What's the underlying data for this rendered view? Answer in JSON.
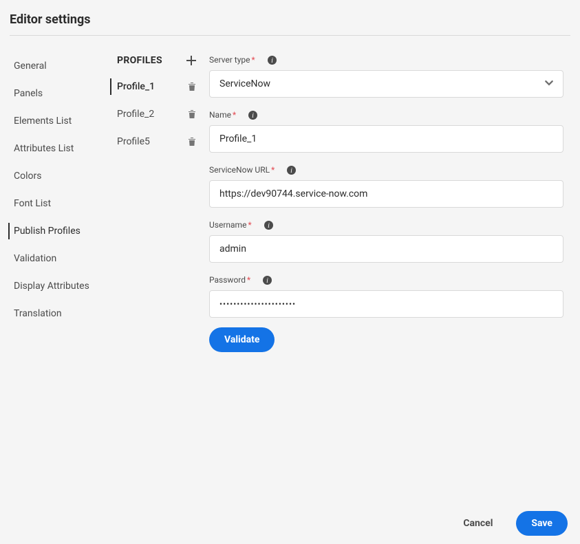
{
  "page_title": "Editor settings",
  "sidebar": {
    "items": [
      {
        "label": "General"
      },
      {
        "label": "Panels"
      },
      {
        "label": "Elements List"
      },
      {
        "label": "Attributes List"
      },
      {
        "label": "Colors"
      },
      {
        "label": "Font List"
      },
      {
        "label": "Publish Profiles"
      },
      {
        "label": "Validation"
      },
      {
        "label": "Display Attributes"
      },
      {
        "label": "Translation"
      }
    ],
    "active_index": 6
  },
  "profiles": {
    "header": "PROFILES",
    "items": [
      {
        "label": "Profile_1"
      },
      {
        "label": "Profile_2"
      },
      {
        "label": "Profile5"
      }
    ],
    "active_index": 0
  },
  "form": {
    "server_type": {
      "label": "Server type",
      "value": "ServiceNow"
    },
    "name": {
      "label": "Name",
      "value": "Profile_1"
    },
    "url": {
      "label": "ServiceNow URL",
      "value": "https://dev90744.service-now.com"
    },
    "username": {
      "label": "Username",
      "value": "admin"
    },
    "password": {
      "label": "Password",
      "value_mask": "••••••••••••••••••••••"
    },
    "validate_label": "Validate"
  },
  "footer": {
    "cancel": "Cancel",
    "save": "Save"
  }
}
